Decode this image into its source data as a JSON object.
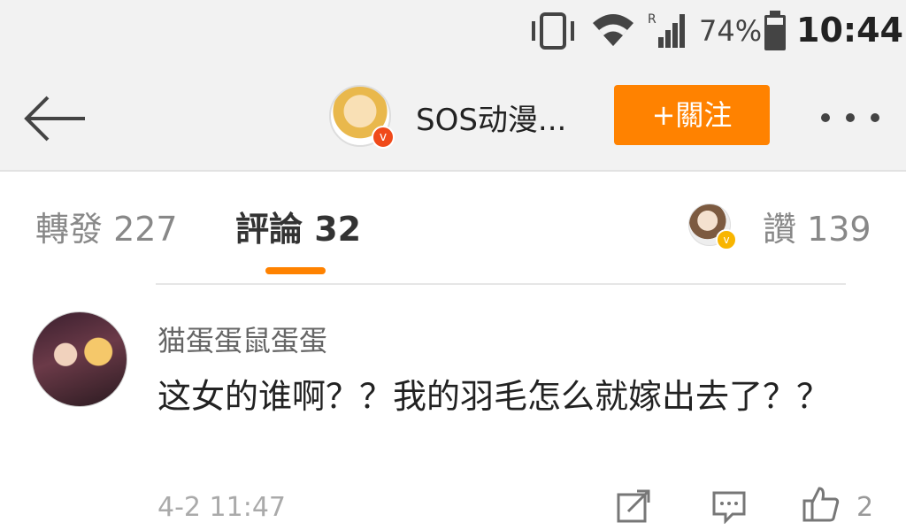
{
  "status_bar": {
    "battery_percent": "74%",
    "time": "10:44",
    "signal_label": "R"
  },
  "header": {
    "title": "SOS动漫...",
    "follow_label": "+關注"
  },
  "tabs": {
    "repost": "轉發 227",
    "comment": "評論 32",
    "likes": "讚 139"
  },
  "comment": {
    "user": "猫蛋蛋鼠蛋蛋",
    "text": "这女的谁啊？？我的羽毛怎么就嫁出去了？？",
    "time": "4-2 11:47",
    "like_count": "2"
  },
  "colors": {
    "accent": "#ff8200",
    "header_bg": "#f2f2f2",
    "verified_red": "#f04a1a",
    "verified_gold": "#f8b500"
  },
  "icons": [
    "vibrate-icon",
    "wifi-icon",
    "signal-icon",
    "battery-icon",
    "back-arrow-icon",
    "more-icon",
    "share-icon",
    "reply-icon",
    "thumbs-up-icon"
  ]
}
